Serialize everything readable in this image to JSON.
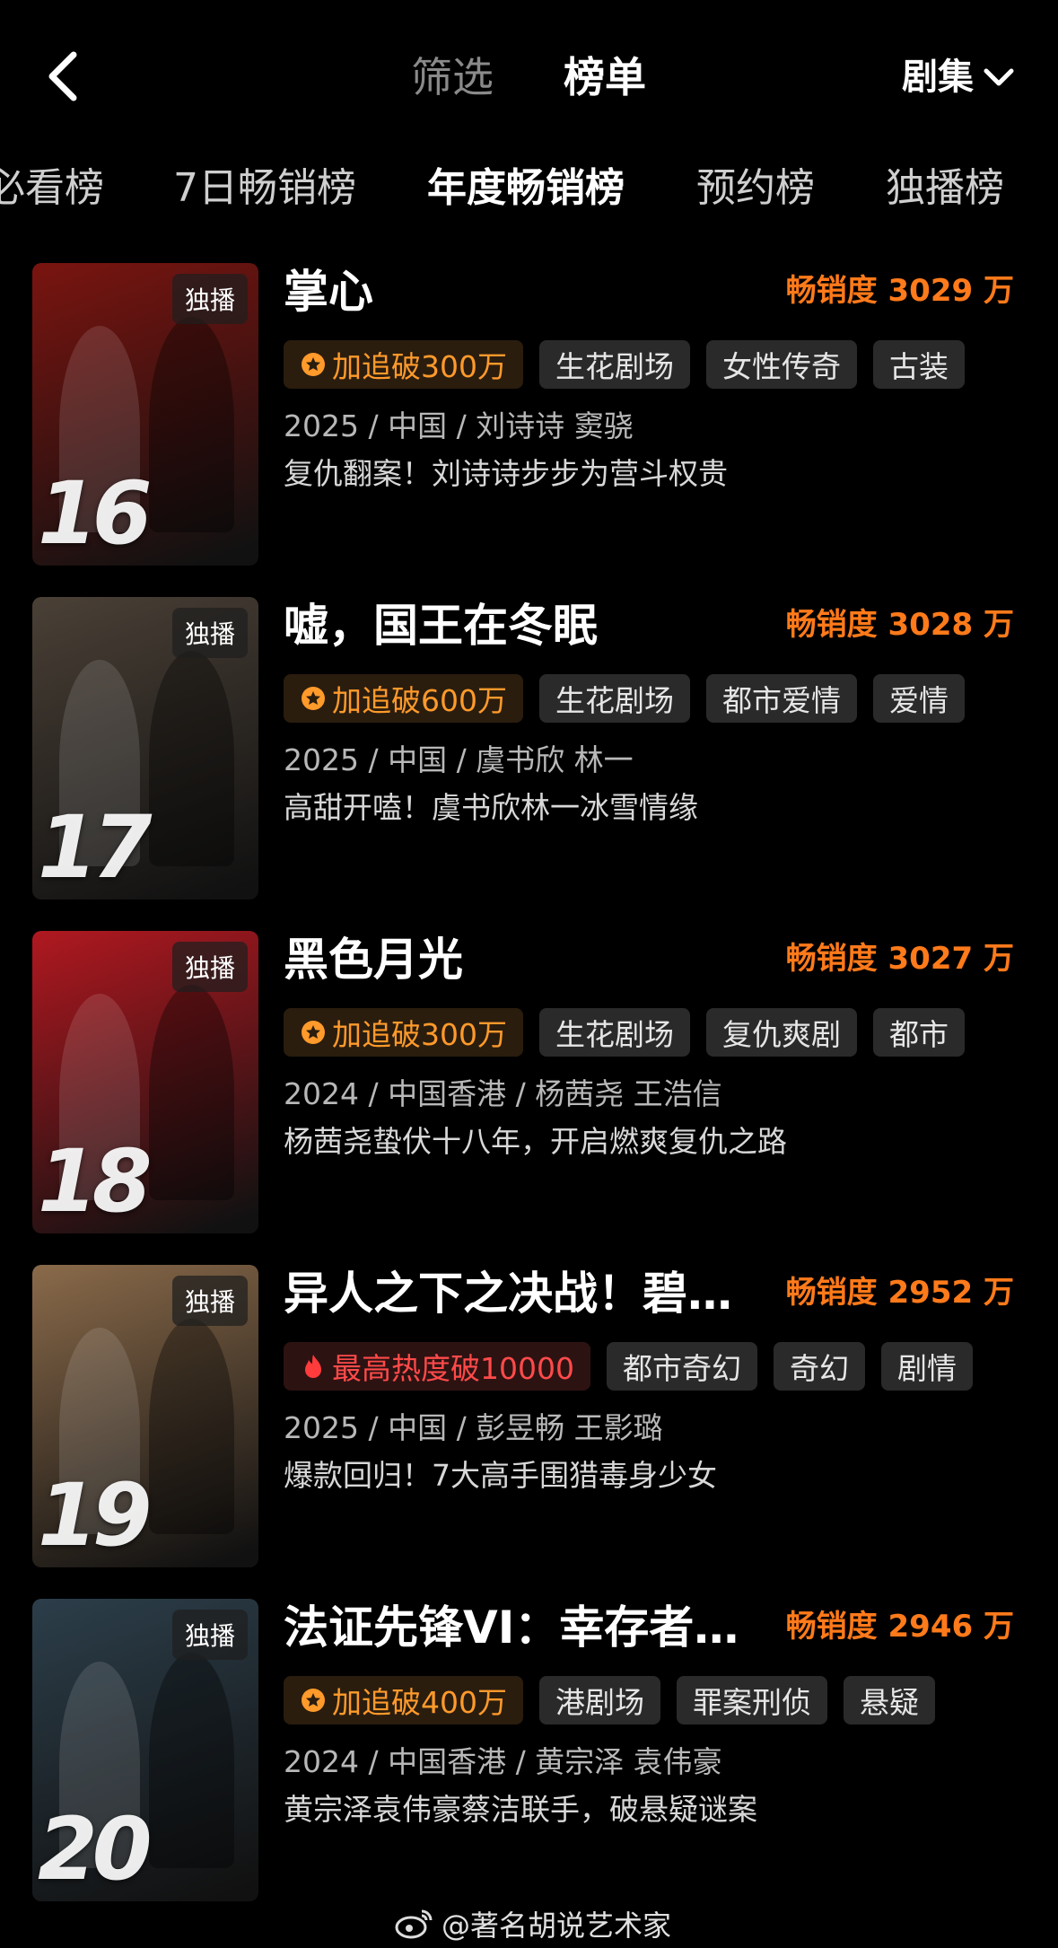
{
  "header": {
    "back_icon": "chevron-left-icon",
    "tabs": [
      {
        "label": "筛选",
        "active": false
      },
      {
        "label": "榜单",
        "active": true
      }
    ],
    "category_select": {
      "value": "剧集",
      "icon": "chevron-down-icon"
    }
  },
  "subtabs": [
    {
      "label": "必看榜",
      "active": false
    },
    {
      "label": "7日畅销榜",
      "active": false
    },
    {
      "label": "年度畅销榜",
      "active": true
    },
    {
      "label": "预约榜",
      "active": false
    },
    {
      "label": "独播榜",
      "active": false
    }
  ],
  "items": [
    {
      "rank": "16",
      "badge": "独播",
      "title": "掌心",
      "sales": "畅销度 3029 万",
      "promo_tag": {
        "kind": "promo",
        "icon": "star-badge-icon",
        "label": "加追破300万"
      },
      "tags": [
        "生花剧场",
        "女性传奇",
        "古装"
      ],
      "meta": "2025 / 中国 / 刘诗诗  窦骁",
      "desc": "复仇翻案！刘诗诗步步为营斗权贵",
      "poster_color": "#7a1410"
    },
    {
      "rank": "17",
      "badge": "独播",
      "title": "嘘，国王在冬眠",
      "sales": "畅销度 3028 万",
      "promo_tag": {
        "kind": "promo",
        "icon": "star-badge-icon",
        "label": "加追破600万"
      },
      "tags": [
        "生花剧场",
        "都市爱情",
        "爱情"
      ],
      "meta": "2025 / 中国 / 虞书欣  林一",
      "desc": "高甜开嗑！虞书欣林一冰雪情缘",
      "poster_color": "#4a4036"
    },
    {
      "rank": "18",
      "badge": "独播",
      "title": "黑色月光",
      "sales": "畅销度 3027 万",
      "promo_tag": {
        "kind": "promo",
        "icon": "star-badge-icon",
        "label": "加追破300万"
      },
      "tags": [
        "生花剧场",
        "复仇爽剧",
        "都市"
      ],
      "meta": "2024 / 中国香港 / 杨茜尧  王浩信",
      "desc": "杨茜尧蛰伏十八年，开启燃爽复仇之路",
      "poster_color": "#b01820"
    },
    {
      "rank": "19",
      "badge": "独播",
      "title": "异人之下之决战！碧…",
      "sales": "畅销度 2952 万",
      "promo_tag": {
        "kind": "hot",
        "icon": "flame-icon",
        "label": "最高热度破10000"
      },
      "tags": [
        "都市奇幻",
        "奇幻",
        "剧情"
      ],
      "meta": "2025 / 中国 / 彭昱畅  王影璐",
      "desc": "爆款回归！7大高手围猎毒身少女",
      "poster_color": "#8a6a4a"
    },
    {
      "rank": "20",
      "badge": "独播",
      "title": "法证先锋VI：幸存者…",
      "sales": "畅销度 2946 万",
      "promo_tag": {
        "kind": "promo",
        "icon": "star-badge-icon",
        "label": "加追破400万"
      },
      "tags": [
        "港剧场",
        "罪案刑侦",
        "悬疑"
      ],
      "meta": "2024 / 中国香港 / 黄宗泽  袁伟豪",
      "desc": "黄宗泽袁伟豪蔡洁联手，破悬疑谜案",
      "poster_color": "#2c3e4a"
    }
  ],
  "watermark": {
    "icon": "weibo-icon",
    "text": "@著名胡说艺术家"
  }
}
